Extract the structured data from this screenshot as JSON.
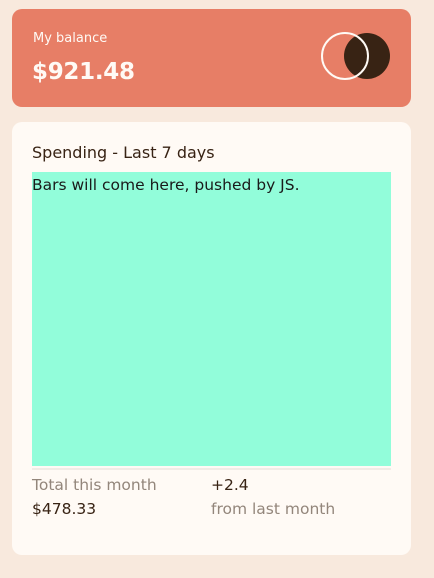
{
  "balance": {
    "label": "My balance",
    "amount": "$921.48"
  },
  "logo": {
    "icon": "overlapping-circles-logo",
    "outline_color": "#fffaf5",
    "fill_color": "#382314"
  },
  "spending": {
    "title": "Spending - Last 7 days",
    "chart_placeholder": "Bars will come here, pushed by JS.",
    "chart_placeholder_color": "#92fdda"
  },
  "summary": {
    "total_label": "Total this month",
    "total_value": "$478.33",
    "change_value": "+2.4",
    "change_label": "from last month"
  },
  "colors": {
    "page_background": "#f8e9dd",
    "balance_card": "#e77e66",
    "card_background": "#fffaf5",
    "text_dark": "#382314",
    "text_muted": "#93867b"
  }
}
